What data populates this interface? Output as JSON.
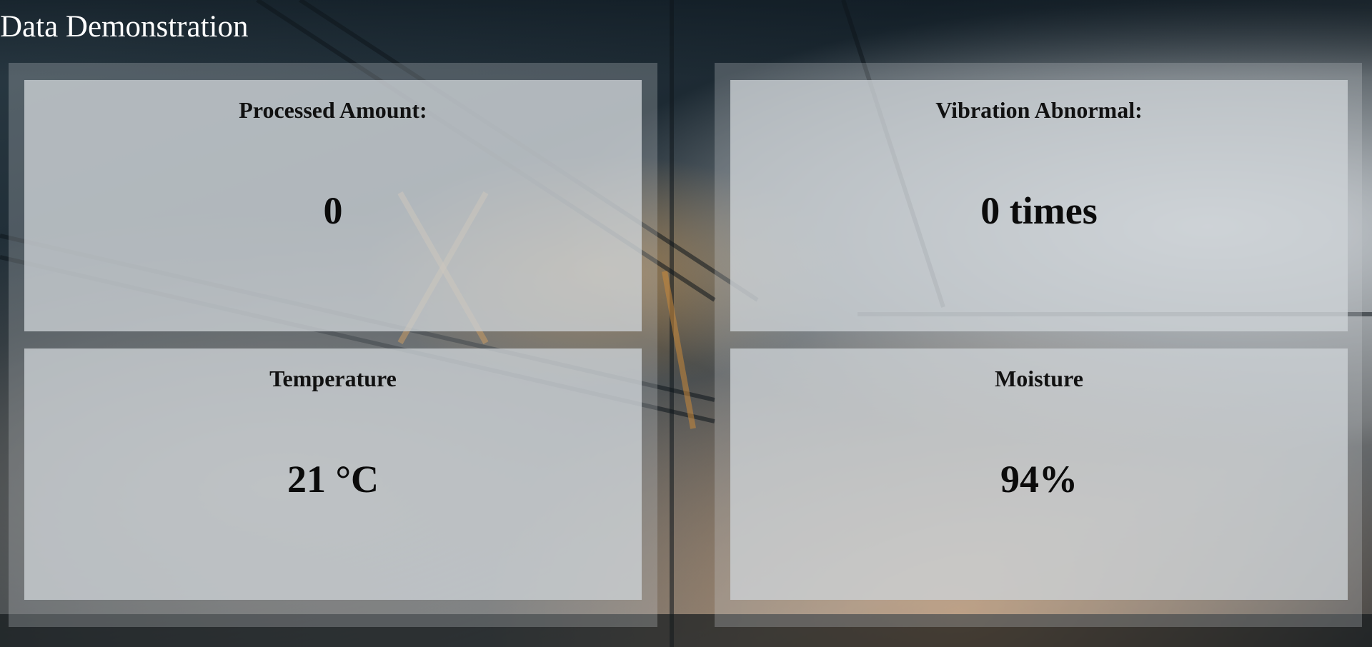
{
  "page": {
    "title": "Data Demonstration"
  },
  "cards": [
    {
      "label": "Processed Amount:",
      "value": "0"
    },
    {
      "label": "Vibration Abnormal:",
      "value": "0 times"
    },
    {
      "label": "Temperature",
      "value": "21 °C"
    },
    {
      "label": "Moisture",
      "value": "94%"
    }
  ]
}
